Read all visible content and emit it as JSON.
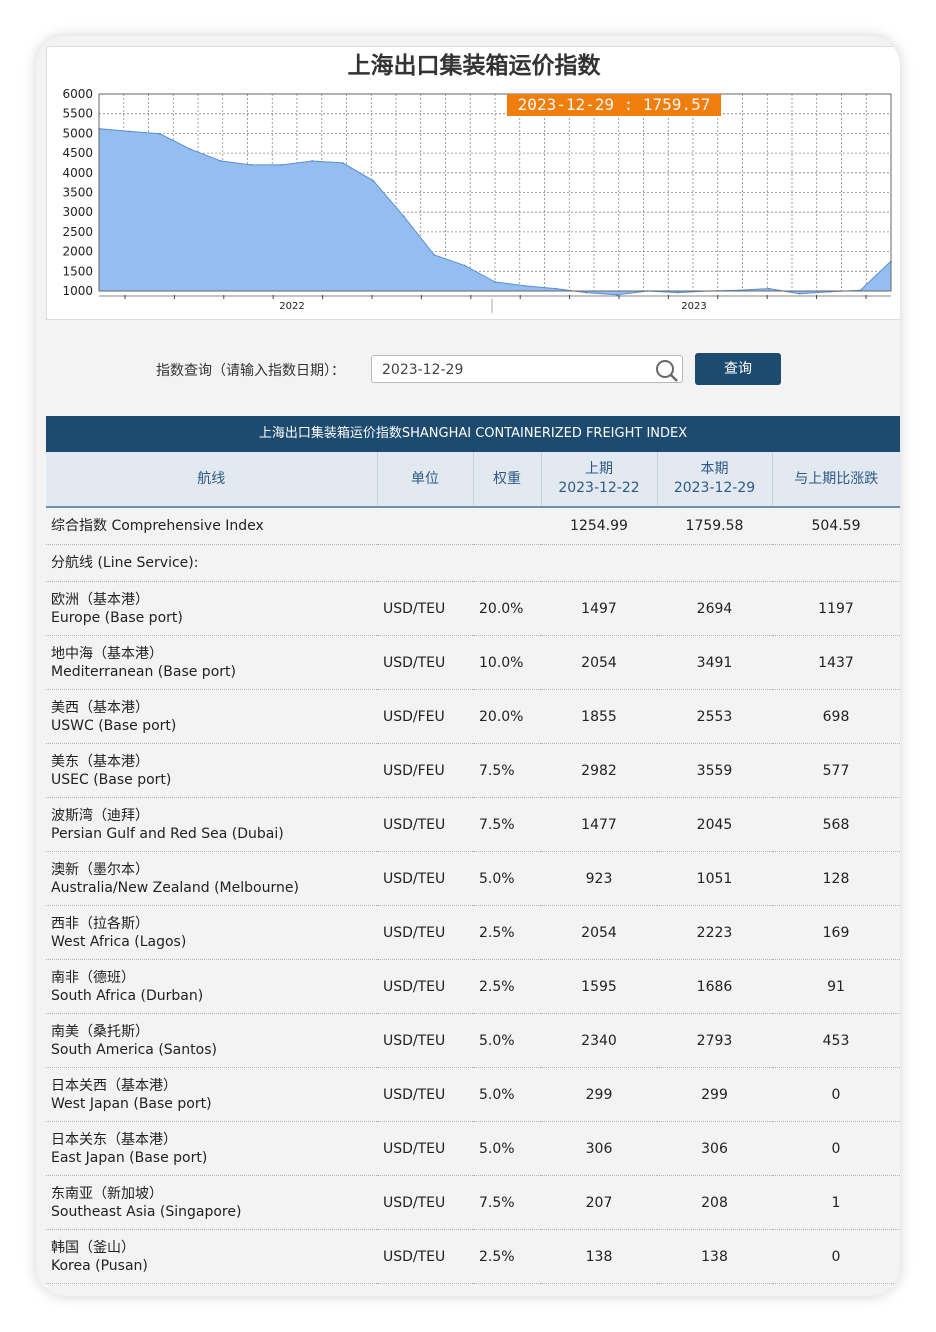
{
  "chart_data": {
    "type": "area",
    "title": "上海出口集装箱运价指数",
    "y_ticks": [
      6000,
      5500,
      5000,
      4500,
      4000,
      3500,
      3000,
      2500,
      2000,
      1500,
      1000
    ],
    "x_year_labels": [
      "2022",
      "2023"
    ],
    "ylim": [
      1000,
      6000
    ],
    "grid": true,
    "fill_color": "#94bdf0",
    "tooltip": "2023-12-29 : 1759.57",
    "tooltip_color": "#f07e0c",
    "x": [
      "2021-10",
      "2021-11",
      "2021-12",
      "2022-01",
      "2022-02",
      "2022-03",
      "2022-04",
      "2022-05",
      "2022-06",
      "2022-07",
      "2022-08",
      "2022-09",
      "2022-10",
      "2022-11",
      "2022-12",
      "2023-01",
      "2023-02",
      "2023-03",
      "2023-04",
      "2023-05",
      "2023-06",
      "2023-07",
      "2023-08",
      "2023-09",
      "2023-10",
      "2023-11",
      "2023-12"
    ],
    "y": [
      5120,
      5050,
      4990,
      4600,
      4300,
      4200,
      4200,
      4300,
      4250,
      3800,
      2900,
      1920,
      1650,
      1230,
      1130,
      1060,
      960,
      900,
      1000,
      960,
      1000,
      1020,
      1060,
      930,
      980,
      1020,
      1760
    ]
  },
  "query": {
    "label": "指数查询（请输入指数日期）：",
    "value": "2023-12-29",
    "button": "查询"
  },
  "table": {
    "banner": "上海出口集装箱运价指数SHANGHAI CONTAINERIZED FREIGHT INDEX",
    "headers": {
      "route": "航线",
      "unit": "单位",
      "weight": "权重",
      "prev": "上期",
      "prev_date": "2023-12-22",
      "curr": "本期",
      "curr_date": "2023-12-29",
      "change": "与上期比涨跌"
    },
    "comprehensive": {
      "label": "综合指数 Comprehensive Index",
      "prev": "1254.99",
      "curr": "1759.58",
      "change": "504.59"
    },
    "line_service_label": "分航线 (Line Service):",
    "rows": [
      {
        "zh": "欧洲（基本港）",
        "en": "Europe (Base port)",
        "unit": "USD/TEU",
        "weight": "20.0%",
        "prev": "1497",
        "curr": "2694",
        "change": "1197"
      },
      {
        "zh": "地中海（基本港）",
        "en": "Mediterranean (Base port)",
        "unit": "USD/TEU",
        "weight": "10.0%",
        "prev": "2054",
        "curr": "3491",
        "change": "1437"
      },
      {
        "zh": "美西（基本港）",
        "en": "USWC (Base port)",
        "unit": "USD/FEU",
        "weight": "20.0%",
        "prev": "1855",
        "curr": "2553",
        "change": "698"
      },
      {
        "zh": "美东（基本港）",
        "en": "USEC (Base port)",
        "unit": "USD/FEU",
        "weight": "7.5%",
        "prev": "2982",
        "curr": "3559",
        "change": "577"
      },
      {
        "zh": "波斯湾（迪拜）",
        "en": "Persian Gulf and Red Sea (Dubai)",
        "unit": "USD/TEU",
        "weight": "7.5%",
        "prev": "1477",
        "curr": "2045",
        "change": "568"
      },
      {
        "zh": "澳新（墨尔本）",
        "en": "Australia/New Zealand (Melbourne)",
        "unit": "USD/TEU",
        "weight": "5.0%",
        "prev": "923",
        "curr": "1051",
        "change": "128"
      },
      {
        "zh": "西非（拉各斯）",
        "en": "West Africa (Lagos)",
        "unit": "USD/TEU",
        "weight": "2.5%",
        "prev": "2054",
        "curr": "2223",
        "change": "169"
      },
      {
        "zh": "南非（德班）",
        "en": "South Africa (Durban)",
        "unit": "USD/TEU",
        "weight": "2.5%",
        "prev": "1595",
        "curr": "1686",
        "change": "91"
      },
      {
        "zh": "南美（桑托斯）",
        "en": "South America (Santos)",
        "unit": "USD/TEU",
        "weight": "5.0%",
        "prev": "2340",
        "curr": "2793",
        "change": "453"
      },
      {
        "zh": "日本关西（基本港）",
        "en": "West Japan (Base port)",
        "unit": "USD/TEU",
        "weight": "5.0%",
        "prev": "299",
        "curr": "299",
        "change": "0"
      },
      {
        "zh": "日本关东（基本港）",
        "en": "East Japan (Base port)",
        "unit": "USD/TEU",
        "weight": "5.0%",
        "prev": "306",
        "curr": "306",
        "change": "0"
      },
      {
        "zh": "东南亚（新加坡）",
        "en": "Southeast Asia (Singapore)",
        "unit": "USD/TEU",
        "weight": "7.5%",
        "prev": "207",
        "curr": "208",
        "change": "1"
      },
      {
        "zh": "韩国（釜山）",
        "en": "Korea (Pusan)",
        "unit": "USD/TEU",
        "weight": "2.5%",
        "prev": "138",
        "curr": "138",
        "change": "0"
      }
    ]
  }
}
